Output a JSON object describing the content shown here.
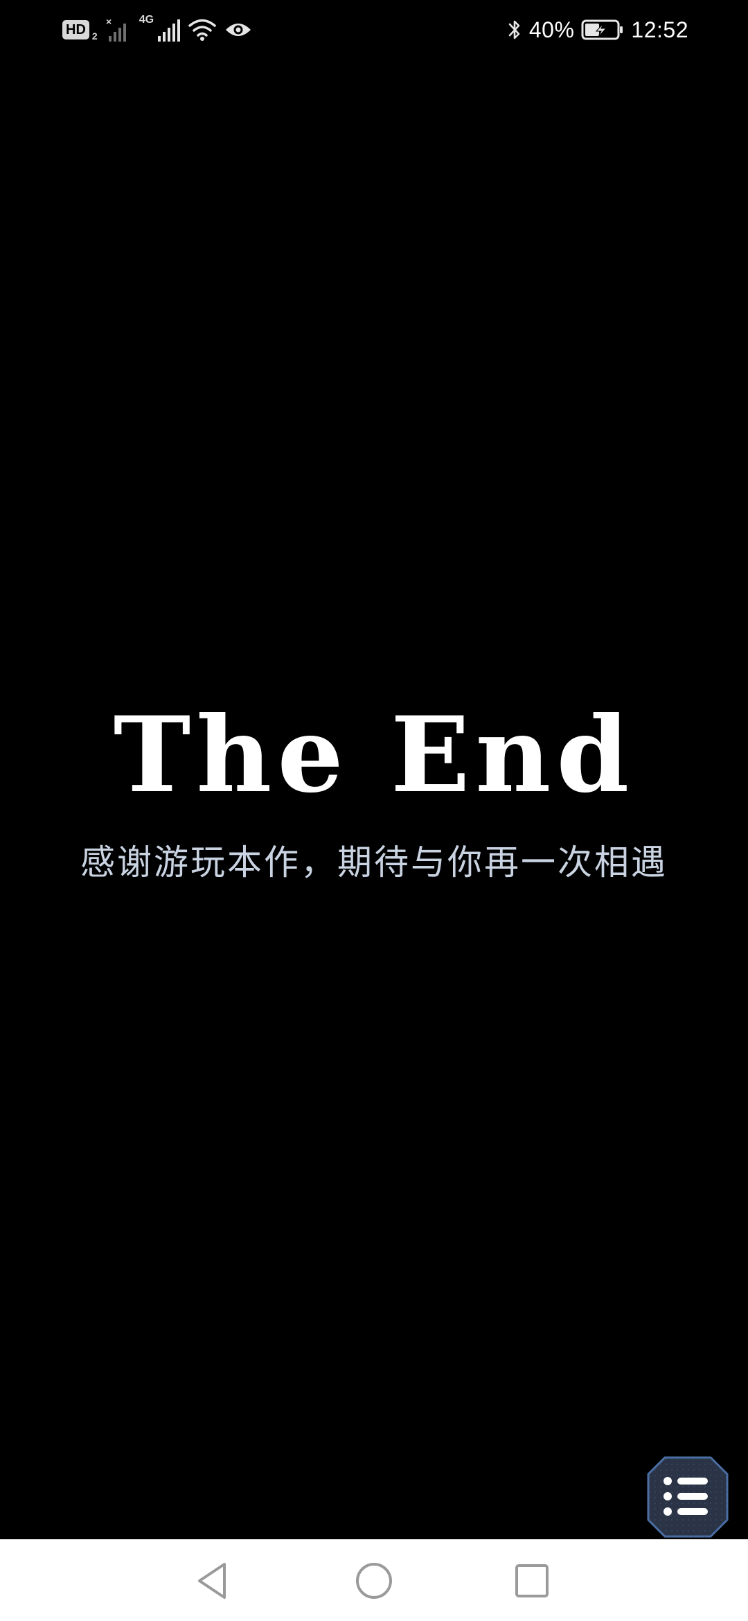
{
  "status_bar": {
    "hd_label": "HD",
    "sim_index": "2",
    "network_type": "4G",
    "battery_percent": "40%",
    "time": "12:52",
    "icons": [
      "hd-icon",
      "signal-no-service-icon",
      "signal-4g-icon",
      "wifi-icon",
      "eye-comfort-icon",
      "bluetooth-icon",
      "battery-charging-icon"
    ]
  },
  "ending": {
    "title": "The End",
    "subtitle": "感谢游玩本作，期待与你再一次相遇"
  },
  "menu_button": {
    "icon": "list-menu-icon"
  },
  "nav_bar": {
    "icons": [
      "back-icon",
      "home-icon",
      "recents-icon"
    ]
  },
  "colors": {
    "background": "#000000",
    "title": "#ffffff",
    "subtitle": "#c9d3e2",
    "menu_button_fill": "#2a3446",
    "menu_button_border": "#4a6fa5",
    "nav_bar_background": "#ffffff",
    "nav_icon": "#9a9a9a"
  }
}
